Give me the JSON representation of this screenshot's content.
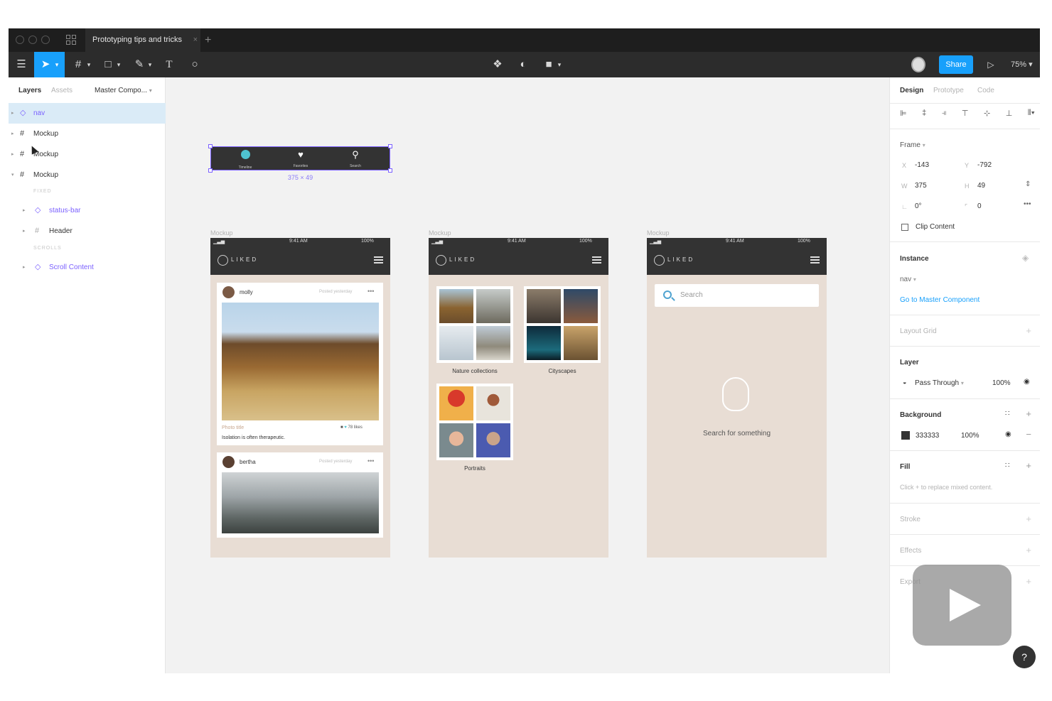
{
  "window": {
    "doc_tab_title": "Prototyping tips and tricks",
    "close_glyph": "×",
    "new_tab_glyph": "+"
  },
  "toolbar": {
    "share_label": "Share",
    "zoom": "75%",
    "icons": [
      "menu-icon",
      "move-tool-icon",
      "frame-tool-icon",
      "shape-tool-icon",
      "pen-tool-icon",
      "text-tool-icon",
      "comment-icon",
      "component-icon",
      "mask-icon",
      "boolean-icon",
      "present-icon"
    ]
  },
  "left_panel": {
    "tabs": [
      "Layers",
      "Assets"
    ],
    "page_selector": "Master Compo...",
    "layers": [
      {
        "name": "nav",
        "kind": "component",
        "selected": true
      },
      {
        "name": "Mockup",
        "kind": "frame"
      },
      {
        "name": "Mockup",
        "kind": "frame"
      },
      {
        "name": "Mockup",
        "kind": "frame",
        "expanded": true
      }
    ],
    "section_fixed": "FIXED",
    "section_scrolls": "SCROLLS",
    "children": [
      {
        "name": "status-bar",
        "kind": "component"
      },
      {
        "name": "Header",
        "kind": "frame"
      },
      {
        "name": "Scroll Content",
        "kind": "component"
      }
    ]
  },
  "canvas": {
    "selection_dims": "375 × 49",
    "nav_items": [
      "Timeline",
      "Favorites",
      "Search"
    ],
    "frame_label": "Mockup",
    "status": {
      "time": "9:41 AM",
      "battery": "100%"
    },
    "brand": "LIKED",
    "feed": {
      "post1_user": "molly",
      "post1_posted": "Posted yesterday",
      "post1_title": "Photo title",
      "post1_caption": "Isolation is often therapeutic.",
      "post1_likes": "78 likes",
      "post2_user": "bertha",
      "post2_posted": "Posted yesterday"
    },
    "collections": [
      "Nature collections",
      "Cityscapes",
      "Portraits"
    ],
    "search_placeholder": "Search",
    "search_empty": "Search for something"
  },
  "right_panel": {
    "tabs": [
      "Design",
      "Prototype",
      "Code"
    ],
    "frame_label": "Frame",
    "x_key": "X",
    "x": "-143",
    "y_key": "Y",
    "y": "-792",
    "w_key": "W",
    "w": "375",
    "h_key": "H",
    "h": "49",
    "rotation": "0°",
    "radius": "0",
    "clip_content": "Clip Content",
    "instance_label": "Instance",
    "instance_name": "nav",
    "master_link": "Go to Master Component",
    "layout_grid": "Layout Grid",
    "layer_label": "Layer",
    "blend_mode": "Pass Through",
    "layer_opacity": "100%",
    "background_label": "Background",
    "bg_hex": "333333",
    "bg_opacity": "100%",
    "fill_label": "Fill",
    "fill_hint": "Click + to replace mixed content.",
    "stroke_label": "Stroke",
    "effects_label": "Effects",
    "export_label": "Export"
  },
  "help_glyph": "?",
  "colors": {
    "accent": "#18a0fb",
    "component": "#7b61ff",
    "mockup_bg": "#e8ddd4",
    "dark": "#333333"
  }
}
